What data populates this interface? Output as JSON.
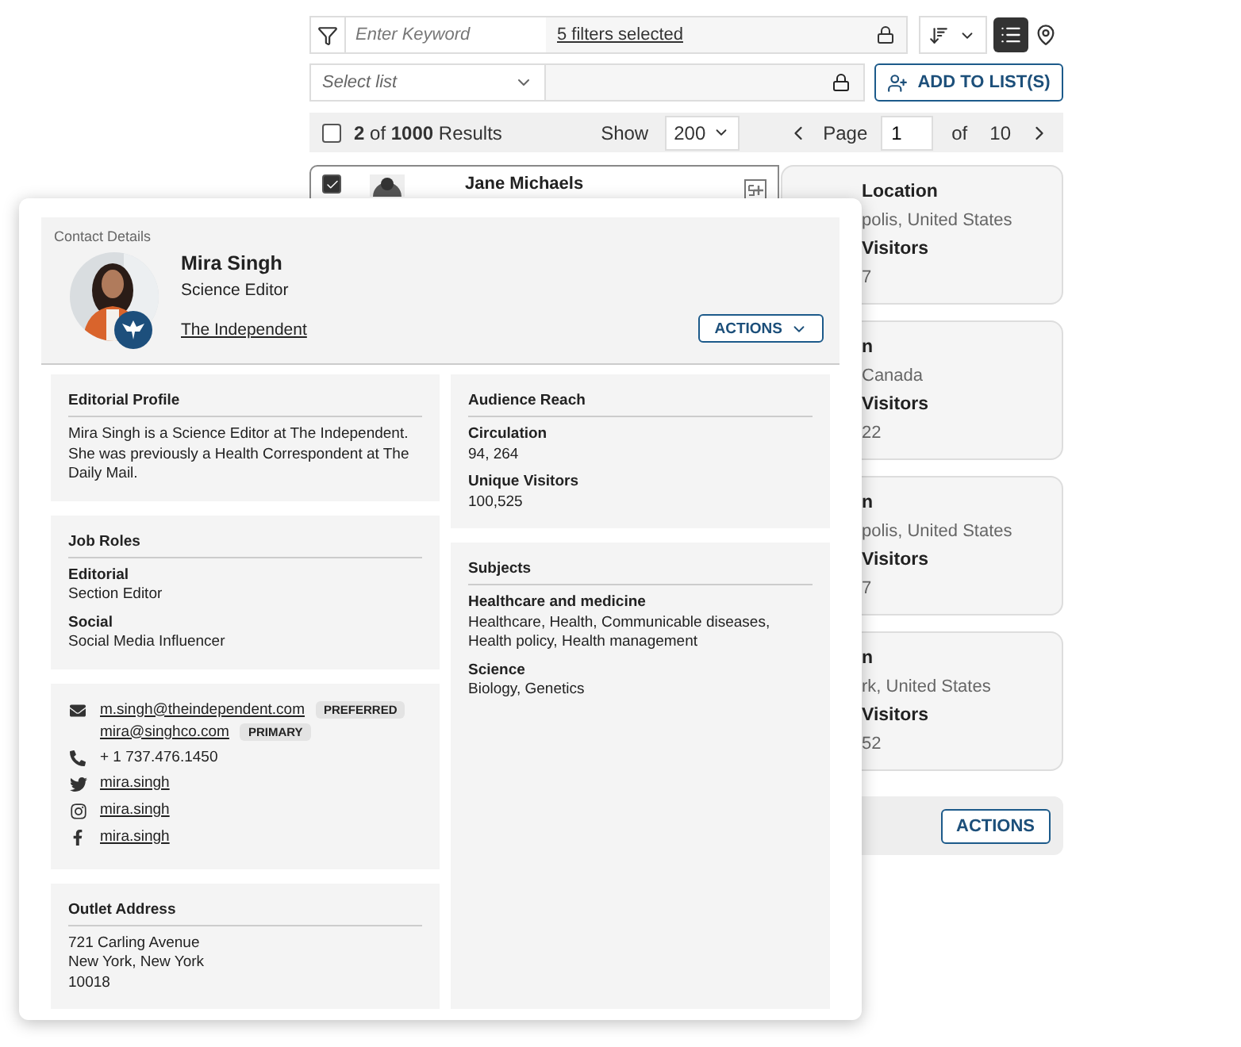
{
  "toolbar": {
    "filter_placeholder": "Enter Keyword",
    "filters_link": "5 filters selected",
    "views": [
      {
        "kind": "list",
        "selected": true
      },
      {
        "kind": "map",
        "selected": false
      }
    ]
  },
  "list_row": {
    "select_placeholder": "Select list",
    "add_button": "ADD TO LIST(S)"
  },
  "results_bar": {
    "all_checked": false,
    "summary": "**2** of **1000** Results",
    "show_label": "Show",
    "show_value": "200",
    "page_label": "Page",
    "page_value": "1",
    "of_label": "of",
    "page_count": "10"
  },
  "results": {
    "first_card": {
      "checked": true,
      "name": "Jane Michaels"
    },
    "cards": [
      {
        "lines": [
          {
            "kind": "label",
            "text": "Location"
          },
          {
            "kind": "value",
            "text": "polis, United States"
          },
          {
            "kind": "label",
            "text": "Visitors"
          },
          {
            "kind": "value",
            "text": "7"
          }
        ]
      },
      {
        "lines": [
          {
            "kind": "label",
            "text": "n"
          },
          {
            "kind": "value",
            "text": "Canada"
          },
          {
            "kind": "label",
            "text": "Visitors"
          },
          {
            "kind": "value",
            "text": "22"
          }
        ]
      },
      {
        "lines": [
          {
            "kind": "label",
            "text": "n"
          },
          {
            "kind": "value",
            "text": "polis, United States"
          },
          {
            "kind": "label",
            "text": "Visitors"
          },
          {
            "kind": "value",
            "text": "7"
          }
        ]
      },
      {
        "lines": [
          {
            "kind": "label",
            "text": "n"
          },
          {
            "kind": "value",
            "text": "rk, United States"
          },
          {
            "kind": "label",
            "text": "Visitors"
          },
          {
            "kind": "value",
            "text": "52"
          }
        ]
      }
    ],
    "actions_button": "ACTIONS"
  },
  "contact": {
    "section_title": "Contact Details",
    "name": "Mira Singh",
    "job_title": "Science Editor",
    "outlet": "The Independent",
    "actions_button": "ACTIONS",
    "left_panels": [
      {
        "kind": "text",
        "heading": "Editorial Profile",
        "body": "Mira Singh is a Science Editor at The Independent. She was previously a Health Correspondent at The Daily Mail."
      },
      {
        "kind": "fields",
        "heading": "Job Roles",
        "items": [
          {
            "label": "Editorial",
            "value": "Section Editor"
          },
          {
            "label": "Social",
            "value": "Social Media Influencer"
          }
        ]
      },
      {
        "kind": "contacts",
        "rows": [
          {
            "kind": "email",
            "entries": [
              {
                "text": "m.singh@theindependent.com",
                "tag": "PREFERRED"
              },
              {
                "text": "mira@singhco.com",
                "tag": "PRIMARY"
              }
            ]
          },
          {
            "kind": "phone",
            "entries": [
              {
                "text": "+ 1 737.476.1450"
              }
            ]
          },
          {
            "kind": "twitter",
            "entries": [
              {
                "text": "mira.singh"
              }
            ]
          },
          {
            "kind": "instagram",
            "entries": [
              {
                "text": "mira.singh"
              }
            ]
          },
          {
            "kind": "facebook",
            "entries": [
              {
                "text": "mira.singh"
              }
            ]
          }
        ]
      },
      {
        "kind": "address",
        "heading": "Outlet Address",
        "lines": [
          "721 Carling Avenue",
          "New York, New York",
          "10018"
        ]
      }
    ],
    "right_panels": [
      {
        "kind": "fields",
        "heading": "Audience Reach",
        "items": [
          {
            "label": "Circulation",
            "value": "94, 264"
          },
          {
            "label": "Unique Visitors",
            "value": "100,525"
          }
        ]
      },
      {
        "kind": "fields",
        "heading": "Subjects",
        "items": [
          {
            "label": "Healthcare and medicine",
            "value": "Healthcare, Health, Communicable diseases, Health policy, Health management"
          },
          {
            "label": "Science",
            "value": "Biology, Genetics"
          }
        ]
      }
    ]
  }
}
